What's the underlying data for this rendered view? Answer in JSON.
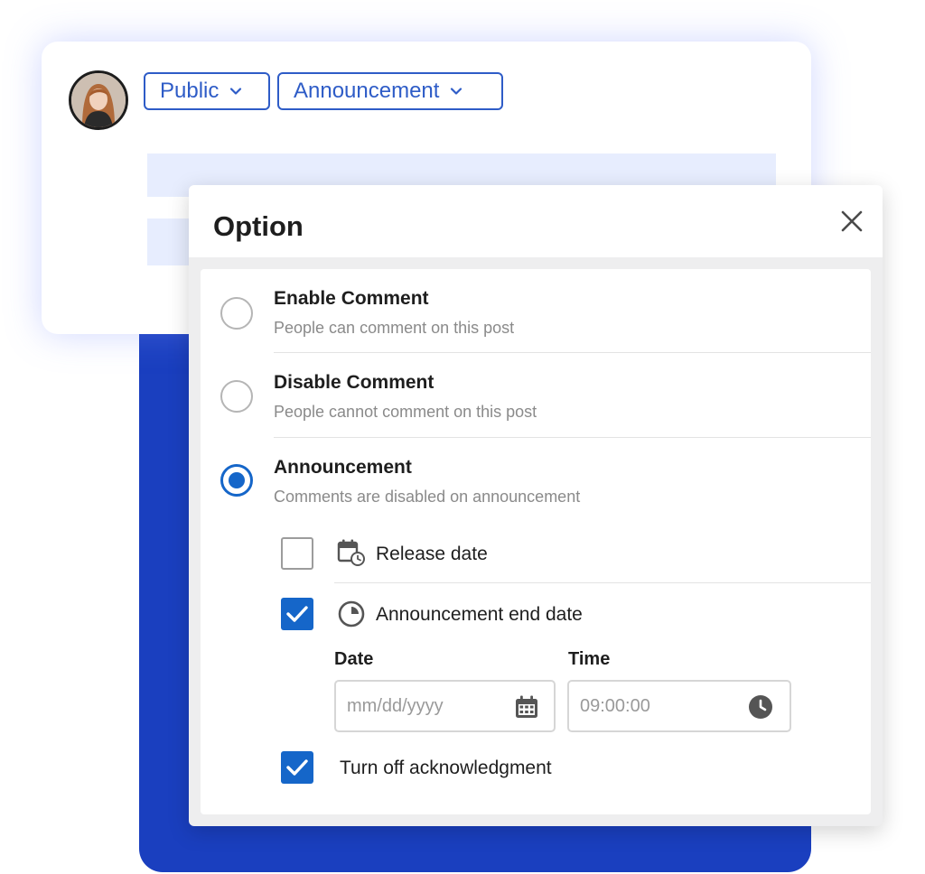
{
  "post": {
    "visibility_label": "Public",
    "type_label": "Announcement"
  },
  "modal": {
    "title": "Option",
    "options": [
      {
        "title": "Enable Comment",
        "description": "People can comment on this post",
        "selected": false
      },
      {
        "title": "Disable Comment",
        "description": "People cannot comment on this post",
        "selected": false
      },
      {
        "title": "Announcement",
        "description": "Comments are disabled on announcement",
        "selected": true
      }
    ],
    "announcement": {
      "release_date_label": "Release date",
      "release_date_checked": false,
      "end_date_label": "Announcement end date",
      "end_date_checked": true,
      "date_label": "Date",
      "date_placeholder": "mm/dd/yyyy",
      "time_label": "Time",
      "time_placeholder": "09:00:00",
      "ack_label": "Turn off acknowledgment",
      "ack_checked": true
    }
  },
  "colors": {
    "accent": "#1566c9",
    "pill_blue": "#2e5cc7",
    "backdrop_blue": "#1a3fbf",
    "skeleton": "#e7edfe"
  },
  "icons": {
    "close": "close-icon",
    "chevron": "chevron-down-icon",
    "release_date": "calendar-clock-icon",
    "end_date": "pie-clock-icon",
    "date_field": "calendar-icon",
    "time_field": "clock-icon",
    "check": "checkmark-icon"
  }
}
